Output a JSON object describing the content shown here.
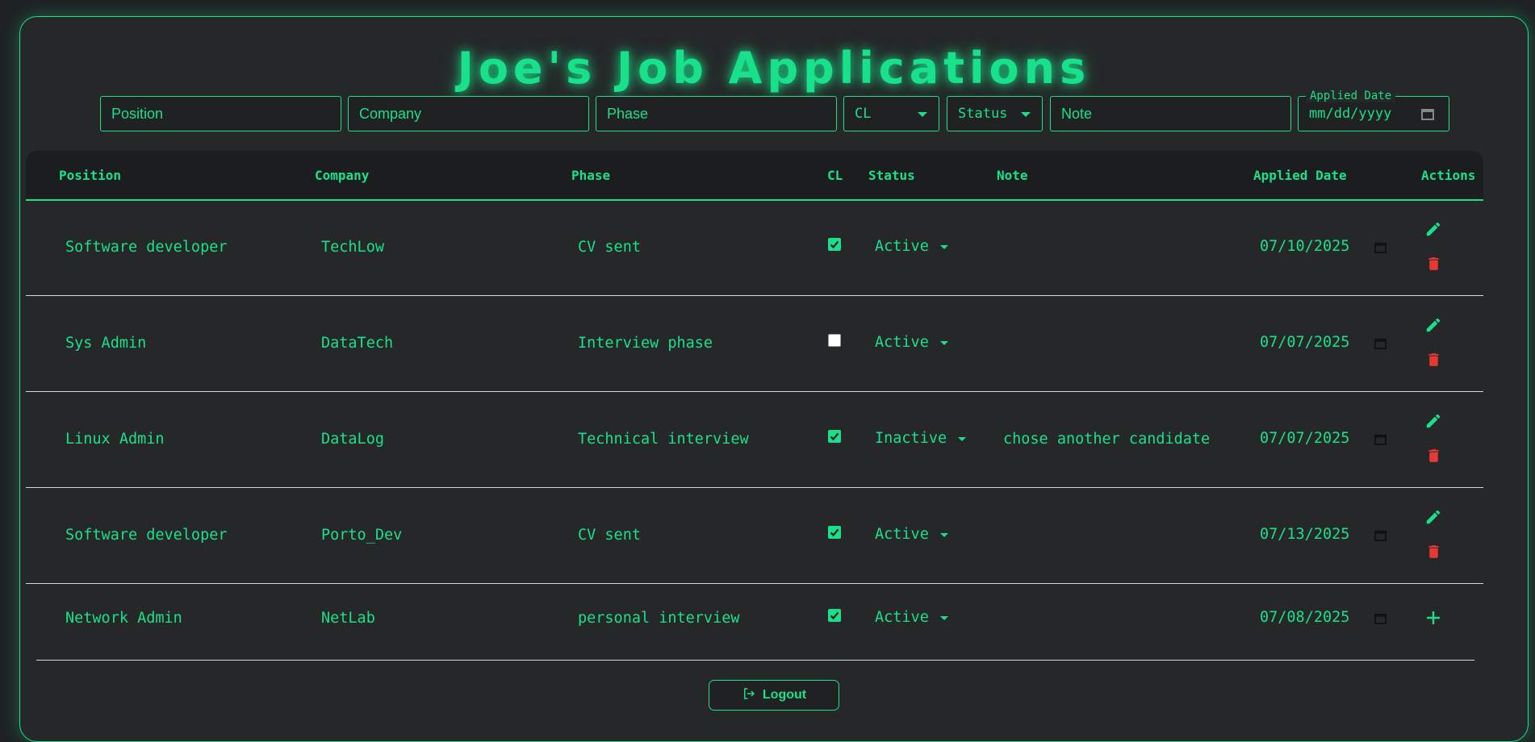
{
  "page_title": "Joe's Job Applications",
  "filters": {
    "position_placeholder": "Position",
    "company_placeholder": "Company",
    "phase_placeholder": "Phase",
    "cl_select": "CL",
    "status_select": "Status",
    "note_placeholder": "Note",
    "date_legend": "Applied Date",
    "date_placeholder": "mm/dd/yyyy"
  },
  "table": {
    "headers": [
      "Position",
      "Company",
      "Phase",
      "CL",
      "Status",
      "Note",
      "Applied Date",
      "Actions"
    ],
    "rows": [
      {
        "position": "Software developer",
        "company": "TechLow",
        "phase": "CV sent",
        "cl": true,
        "status": "Active",
        "note": "",
        "date": "07/10/2025"
      },
      {
        "position": "Sys Admin",
        "company": "DataTech",
        "phase": "Interview phase",
        "cl": false,
        "status": "Active",
        "note": "",
        "date": "07/07/2025"
      },
      {
        "position": "Linux Admin",
        "company": "DataLog",
        "phase": "Technical interview",
        "cl": true,
        "status": "Inactive",
        "note": "chose another candidate",
        "date": "07/07/2025"
      },
      {
        "position": "Software developer",
        "company": "Porto_Dev",
        "phase": "CV sent",
        "cl": true,
        "status": "Active",
        "note": "",
        "date": "07/13/2025"
      }
    ],
    "new_row": {
      "position": "Network Admin",
      "company": "NetLab",
      "phase": "personal interview",
      "cl": true,
      "status": "Active",
      "note": "",
      "date": "07/08/2025"
    }
  },
  "logout_label": "Logout",
  "colors": {
    "accent": "#19e08a",
    "danger": "#e53935",
    "background": "#262729"
  },
  "icons": {
    "edit": "pencil-icon",
    "delete": "trash-icon",
    "add": "plus-icon",
    "calendar": "calendar-icon",
    "logout": "logout-icon"
  }
}
